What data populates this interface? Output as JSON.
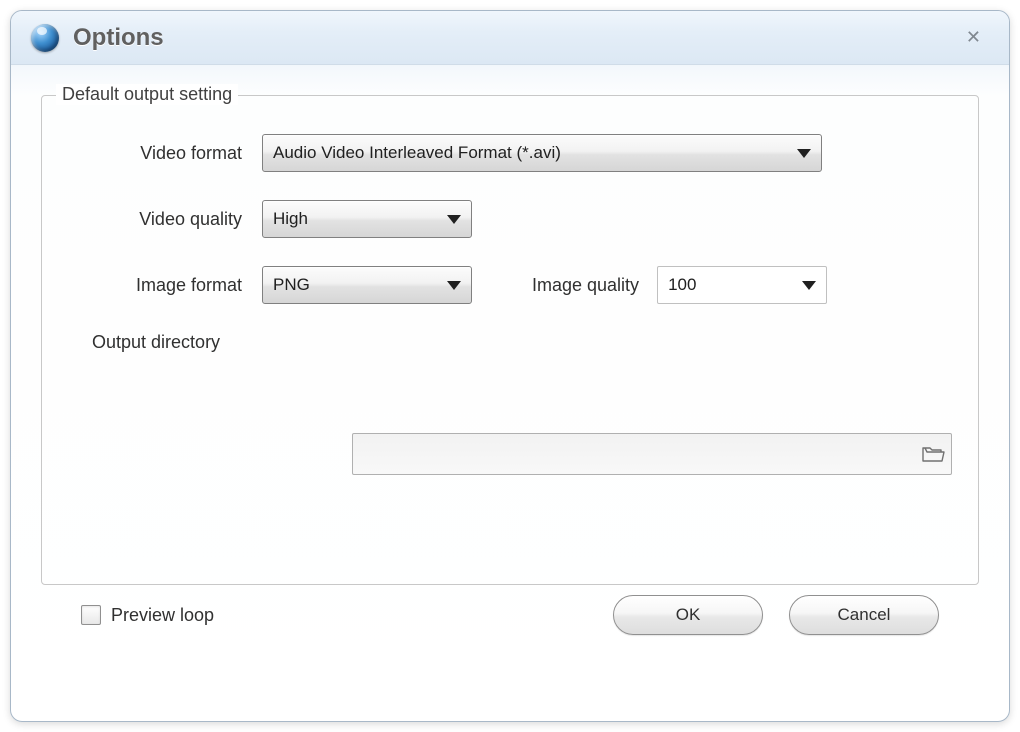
{
  "title": "Options",
  "group": {
    "legend": "Default output setting",
    "video_format_label": "Video format",
    "video_format_value": "Audio Video Interleaved Format (*.avi)",
    "video_quality_label": "Video quality",
    "video_quality_value": "High",
    "image_format_label": "Image format",
    "image_format_value": "PNG",
    "image_quality_label": "Image quality",
    "image_quality_value": "100",
    "output_dir_label": "Output directory",
    "output_dir_value": ""
  },
  "footer": {
    "preview_loop_label": "Preview loop",
    "preview_loop_checked": false,
    "ok_label": "OK",
    "cancel_label": "Cancel"
  }
}
